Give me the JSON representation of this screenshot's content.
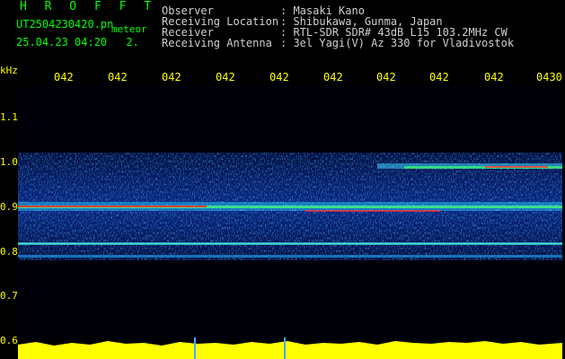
{
  "app": {
    "title": "H R O F F T"
  },
  "file": {
    "name": "UT2504230420.pn",
    "label": "meteor",
    "timestamp": "25.04.23 04:20",
    "page_mark": "2."
  },
  "header": {
    "rows": [
      {
        "label": "Observer",
        "value": ": Masaki Kano"
      },
      {
        "label": "Receiving Location",
        "value": ": Shibukawa, Gunma, Japan"
      },
      {
        "label": "Receiver",
        "value": ": RTL-SDR SDR# 43dB L15 103.2MHz CW"
      },
      {
        "label": "Receiving Antenna",
        "value": ": 3el Yagi(V) Az 330 for Vladivostok"
      }
    ]
  },
  "axis": {
    "unit": "kHz",
    "time_ticks": [
      "042",
      "042",
      "042",
      "042",
      "042",
      "042",
      "042",
      "042",
      "042",
      "0430"
    ],
    "freq_ticks": [
      "1.1",
      "1.0",
      "0.9",
      "0.8",
      "0.7",
      "0.6"
    ]
  },
  "colors": {
    "label": "#00ff00",
    "tick": "#ffff00",
    "text": "#cfcfcf",
    "signal": "#ff3030"
  }
}
